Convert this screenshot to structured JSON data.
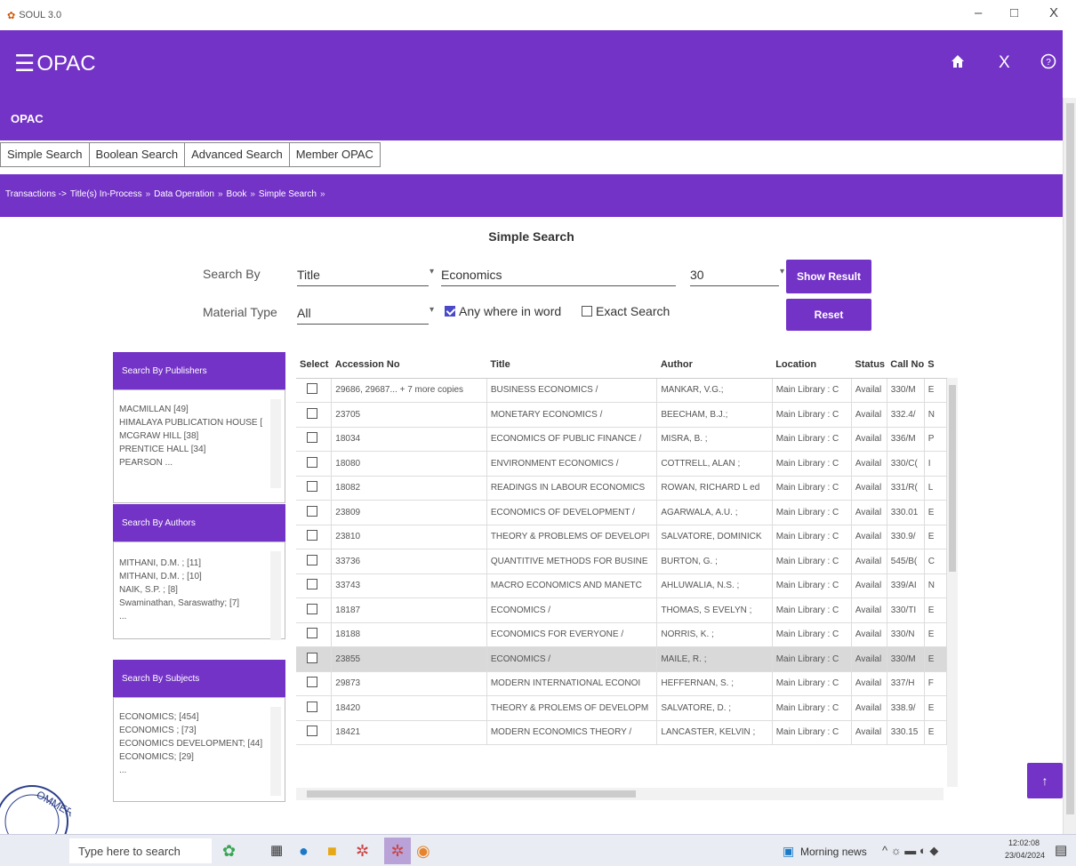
{
  "window": {
    "title": "SOUL 3.0",
    "minimize": "–",
    "maximize": "□",
    "close": "X"
  },
  "header": {
    "app_name": "OPAC",
    "home_icon": "home-icon",
    "close_label": "X",
    "help_label": "?"
  },
  "subheader": {
    "title": "OPAC"
  },
  "tabs": [
    {
      "label": "Simple Search"
    },
    {
      "label": "Boolean Search"
    },
    {
      "label": "Advanced Search"
    },
    {
      "label": "Member OPAC"
    }
  ],
  "breadcrumb": [
    "Transactions ->",
    "Title(s) In-Process",
    "Data Operation",
    "Book",
    "Simple Search"
  ],
  "breadcrumb_sep": "»",
  "form": {
    "page_title": "Simple Search",
    "search_by_label": "Search By",
    "search_by_value": "Title",
    "keyword_value": "Economics",
    "count_value": "30",
    "material_type_label": "Material Type",
    "material_type_value": "All",
    "anywhere_label": "Any where in word",
    "anywhere_checked": true,
    "exact_label": "Exact Search",
    "exact_checked": false,
    "show_result_label": "Show Result",
    "reset_label": "Reset"
  },
  "facets": {
    "publishers": {
      "title": "Search By Publishers",
      "items": [
        "MACMILLAN [49]",
        "HIMALAYA PUBLICATION HOUSE [",
        "MCGRAW HILL [38]",
        "PRENTICE HALL [34]",
        "PEARSON ..."
      ]
    },
    "authors": {
      "title": "Search By Authors",
      "items": [
        "MITHANI, D.M. ; [11]",
        "MITHANI, D.M. ; [10]",
        "NAIK, S.P. ; [8]",
        "Swaminathan, Saraswathy; [7]",
        "..."
      ]
    },
    "subjects": {
      "title": "Search By Subjects",
      "items": [
        "ECONOMICS; [454]",
        "ECONOMICS ; [73]",
        "ECONOMICS DEVELOPMENT; [44]",
        "ECONOMICS; [29]",
        "..."
      ]
    }
  },
  "table": {
    "columns": [
      "Select",
      "Accession No",
      "Title",
      "Author",
      "Location",
      "Status",
      "Call No",
      "S"
    ],
    "rows": [
      {
        "acc": "29686, 29687... + 7 more copies",
        "title": "BUSINESS ECONOMICS /",
        "author": "MANKAR, V.G.;",
        "location": "Main Library : C",
        "status": "Availal",
        "call": "330/M",
        "s": "E",
        "selected": false
      },
      {
        "acc": "23705",
        "title": "MONETARY ECONOMICS /",
        "author": "BEECHAM, B.J.;",
        "location": "Main Library : C",
        "status": "Availal",
        "call": "332.4/",
        "s": "N",
        "selected": false
      },
      {
        "acc": "18034",
        "title": "ECONOMICS OF PUBLIC FINANCE /",
        "author": "MISRA, B. ;",
        "location": "Main Library : C",
        "status": "Availal",
        "call": "336/M",
        "s": "P",
        "selected": false
      },
      {
        "acc": "18080",
        "title": "ENVIRONMENT ECONOMICS /",
        "author": "COTTRELL, ALAN ;",
        "location": "Main Library : C",
        "status": "Availal",
        "call": "330/C(",
        "s": "I",
        "selected": false
      },
      {
        "acc": "18082",
        "title": "READINGS IN LABOUR ECONOMICS",
        "author": "ROWAN, RICHARD L ed",
        "location": "Main Library : C",
        "status": "Availal",
        "call": "331/R(",
        "s": "L",
        "selected": false
      },
      {
        "acc": "23809",
        "title": "ECONOMICS OF DEVELOPMENT /",
        "author": "AGARWALA, A.U. ;",
        "location": "Main Library : C",
        "status": "Availal",
        "call": "330.01",
        "s": "E",
        "selected": false
      },
      {
        "acc": "23810",
        "title": "THEORY & PROBLEMS OF DEVELOPI",
        "author": "SALVATORE, DOMINICK",
        "location": "Main Library : C",
        "status": "Availal",
        "call": "330.9/",
        "s": "E",
        "selected": false
      },
      {
        "acc": "33736",
        "title": "QUANTITIVE METHODS FOR BUSINE",
        "author": "BURTON, G. ;",
        "location": "Main Library : C",
        "status": "Availal",
        "call": "545/B(",
        "s": "C",
        "selected": false
      },
      {
        "acc": "33743",
        "title": "MACRO ECONOMICS AND MANETC",
        "author": "AHLUWALIA, N.S. ;",
        "location": "Main Library : C",
        "status": "Availal",
        "call": "339/AI",
        "s": "N",
        "selected": false
      },
      {
        "acc": "18187",
        "title": "ECONOMICS /",
        "author": "THOMAS, S EVELYN ;",
        "location": "Main Library : C",
        "status": "Availal",
        "call": "330/TI",
        "s": "E",
        "selected": false
      },
      {
        "acc": "18188",
        "title": "ECONOMICS FOR EVERYONE /",
        "author": "NORRIS, K. ;",
        "location": "Main Library : C",
        "status": "Availal",
        "call": "330/N",
        "s": "E",
        "selected": false
      },
      {
        "acc": "23855",
        "title": "ECONOMICS /",
        "author": "MAILE, R. ;",
        "location": "Main Library : C",
        "status": "Availal",
        "call": "330/M",
        "s": "E",
        "selected": true
      },
      {
        "acc": "29873",
        "title": "MODERN INTERNATIONAL ECONOI",
        "author": "HEFFERNAN, S. ;",
        "location": "Main Library : C",
        "status": "Availal",
        "call": "337/H",
        "s": "F",
        "selected": false
      },
      {
        "acc": "18420",
        "title": "THEORY & PROLEMS OF DEVELOPM",
        "author": "SALVATORE, D. ;",
        "location": "Main Library : C",
        "status": "Availal",
        "call": "338.9/",
        "s": "E",
        "selected": false
      },
      {
        "acc": "18421",
        "title": "MODERN ECONOMICS THEORY /",
        "author": "LANCASTER, KELVIN ;",
        "location": "Main Library : C",
        "status": "Availal",
        "call": "330.15",
        "s": "E",
        "selected": false
      }
    ]
  },
  "fab": {
    "label": "↑"
  },
  "taskbar": {
    "search_placeholder": "Type here to search",
    "news": "Morning news",
    "time": "12:02:08",
    "date": "23/04/2024"
  },
  "colors": {
    "brand": "#7433c7",
    "highlight_row": "#d9d9d9"
  }
}
